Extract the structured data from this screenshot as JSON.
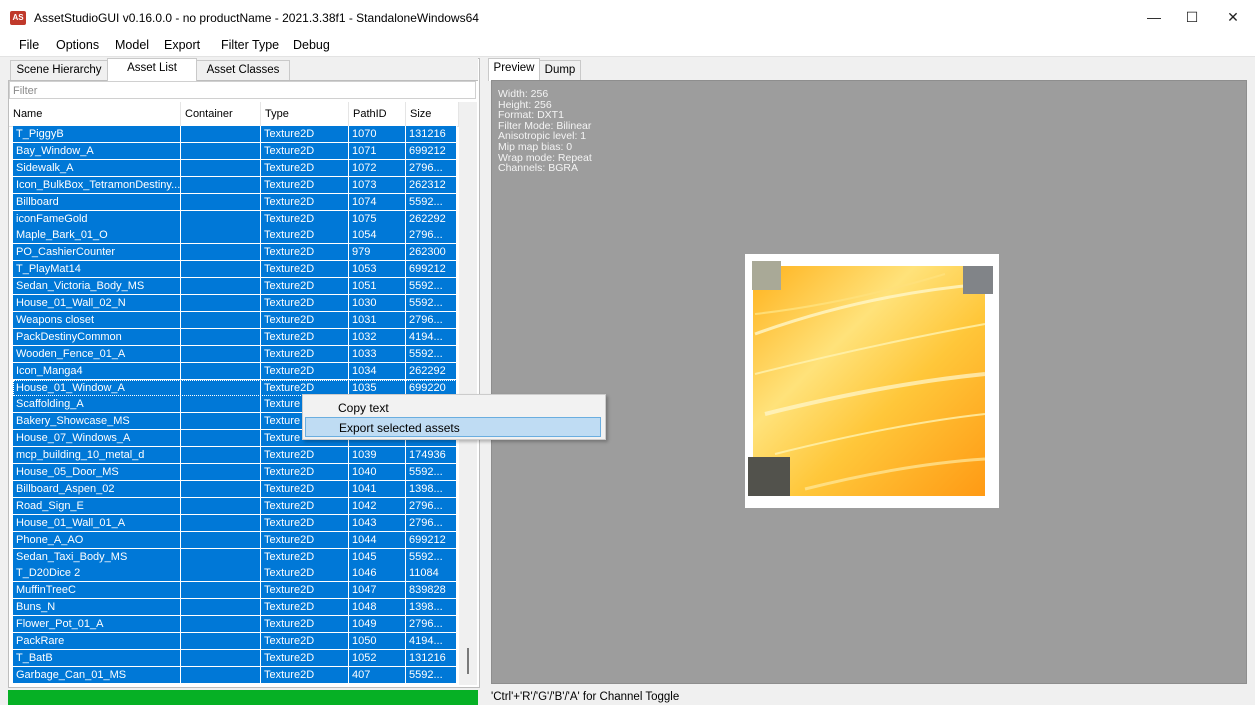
{
  "window": {
    "app_icon_text": "AS",
    "title": "AssetStudioGUI v0.16.0.0 - no productName - 2021.3.38f1 - StandaloneWindows64",
    "minimize_glyph": "—",
    "maximize_glyph": "☐",
    "close_glyph": "✕"
  },
  "menu": [
    "File",
    "Options",
    "Model",
    "Export",
    "Filter Type",
    "Debug"
  ],
  "left_tabs": [
    "Scene Hierarchy",
    "Asset List",
    "Asset Classes"
  ],
  "filter_placeholder": "Filter",
  "columns": [
    "Name",
    "Container",
    "Type",
    "PathID",
    "Size"
  ],
  "rows": [
    {
      "name": "T_PiggyB",
      "container": "",
      "type": "Texture2D",
      "path_id": "1070",
      "size": "131216"
    },
    {
      "name": "Bay_Window_A",
      "container": "",
      "type": "Texture2D",
      "path_id": "1071",
      "size": "699212"
    },
    {
      "name": "Sidewalk_A",
      "container": "",
      "type": "Texture2D",
      "path_id": "1072",
      "size": "2796..."
    },
    {
      "name": "Icon_BulkBox_TetramonDestiny...",
      "container": "",
      "type": "Texture2D",
      "path_id": "1073",
      "size": "262312"
    },
    {
      "name": "Billboard",
      "container": "",
      "type": "Texture2D",
      "path_id": "1074",
      "size": "5592..."
    },
    {
      "name": "iconFameGold",
      "container": "",
      "type": "Texture2D",
      "path_id": "1075",
      "size": "262292"
    },
    {
      "name": "Maple_Bark_01_O",
      "container": "",
      "type": "Texture2D",
      "path_id": "1054",
      "size": "2796..."
    },
    {
      "name": "PO_CashierCounter",
      "container": "",
      "type": "Texture2D",
      "path_id": "979",
      "size": "262300"
    },
    {
      "name": "T_PlayMat14",
      "container": "",
      "type": "Texture2D",
      "path_id": "1053",
      "size": "699212"
    },
    {
      "name": "Sedan_Victoria_Body_MS",
      "container": "",
      "type": "Texture2D",
      "path_id": "1051",
      "size": "5592..."
    },
    {
      "name": "House_01_Wall_02_N",
      "container": "",
      "type": "Texture2D",
      "path_id": "1030",
      "size": "5592..."
    },
    {
      "name": "Weapons closet",
      "container": "",
      "type": "Texture2D",
      "path_id": "1031",
      "size": "2796..."
    },
    {
      "name": "PackDestinyCommon",
      "container": "",
      "type": "Texture2D",
      "path_id": "1032",
      "size": "4194..."
    },
    {
      "name": "Wooden_Fence_01_A",
      "container": "",
      "type": "Texture2D",
      "path_id": "1033",
      "size": "5592..."
    },
    {
      "name": "Icon_Manga4",
      "container": "",
      "type": "Texture2D",
      "path_id": "1034",
      "size": "262292"
    },
    {
      "name": "House_01_Window_A",
      "container": "",
      "type": "Texture2D",
      "path_id": "1035",
      "size": "699220"
    },
    {
      "name": "Scaffolding_A",
      "container": "",
      "type": "Texture",
      "path_id": "",
      "size": ""
    },
    {
      "name": "Bakery_Showcase_MS",
      "container": "",
      "type": "Texture",
      "path_id": "",
      "size": ""
    },
    {
      "name": "House_07_Windows_A",
      "container": "",
      "type": "Texture",
      "path_id": "",
      "size": ""
    },
    {
      "name": "mcp_building_10_metal_d",
      "container": "",
      "type": "Texture2D",
      "path_id": "1039",
      "size": "174936"
    },
    {
      "name": "House_05_Door_MS",
      "container": "",
      "type": "Texture2D",
      "path_id": "1040",
      "size": "5592..."
    },
    {
      "name": "Billboard_Aspen_02",
      "container": "",
      "type": "Texture2D",
      "path_id": "1041",
      "size": "1398..."
    },
    {
      "name": "Road_Sign_E",
      "container": "",
      "type": "Texture2D",
      "path_id": "1042",
      "size": "2796..."
    },
    {
      "name": "House_01_Wall_01_A",
      "container": "",
      "type": "Texture2D",
      "path_id": "1043",
      "size": "2796..."
    },
    {
      "name": "Phone_A_AO",
      "container": "",
      "type": "Texture2D",
      "path_id": "1044",
      "size": "699212"
    },
    {
      "name": "Sedan_Taxi_Body_MS",
      "container": "",
      "type": "Texture2D",
      "path_id": "1045",
      "size": "5592..."
    },
    {
      "name": "T_D20Dice 2",
      "container": "",
      "type": "Texture2D",
      "path_id": "1046",
      "size": "11084"
    },
    {
      "name": "MuffinTreeC",
      "container": "",
      "type": "Texture2D",
      "path_id": "1047",
      "size": "839828"
    },
    {
      "name": "Buns_N",
      "container": "",
      "type": "Texture2D",
      "path_id": "1048",
      "size": "1398..."
    },
    {
      "name": "Flower_Pot_01_A",
      "container": "",
      "type": "Texture2D",
      "path_id": "1049",
      "size": "2796..."
    },
    {
      "name": "PackRare",
      "container": "",
      "type": "Texture2D",
      "path_id": "1050",
      "size": "4194..."
    },
    {
      "name": "T_BatB",
      "container": "",
      "type": "Texture2D",
      "path_id": "1052",
      "size": "131216"
    },
    {
      "name": "Garbage_Can_01_MS",
      "container": "",
      "type": "Texture2D",
      "path_id": "407",
      "size": "5592..."
    }
  ],
  "progress_fraction": 1.0,
  "right_tabs": [
    "Preview",
    "Dump"
  ],
  "preview_info": [
    "Width: 256",
    "Height: 256",
    "Format: DXT1",
    "Filter Mode: Bilinear",
    "Anisotropic level: 1",
    "Mip map bias: 0",
    "Wrap mode: Repeat",
    "Channels: BGRA"
  ],
  "status_text": "'Ctrl'+'R'/'G'/'B'/'A' for Channel Toggle",
  "context_menu": [
    "Copy text",
    "Export selected assets"
  ],
  "colors": {
    "selection": "#0078d7",
    "preview_bg": "#9d9d9d",
    "progress": "#06b025",
    "menu_hover": "#bfdcf3"
  }
}
